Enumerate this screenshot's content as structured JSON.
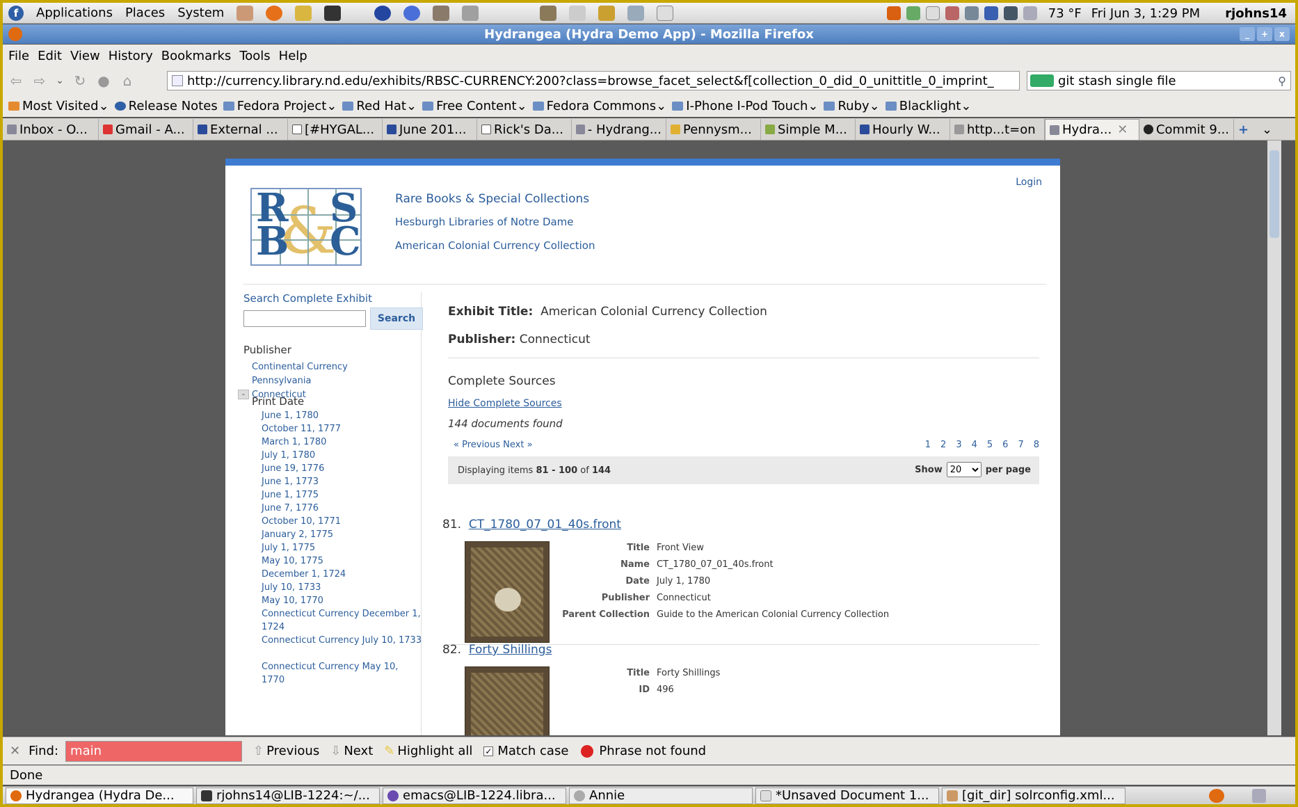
{
  "panel": {
    "menus": [
      "Applications",
      "Places",
      "System"
    ],
    "weather": "73 °F",
    "clock": "Fri Jun  3,  1:29 PM",
    "user": "rjohns14"
  },
  "window": {
    "title": "Hydrangea (Hydra Demo App) - Mozilla Firefox"
  },
  "menubar": [
    "File",
    "Edit",
    "View",
    "History",
    "Bookmarks",
    "Tools",
    "Help"
  ],
  "navbar": {
    "url": "http://currency.library.nd.edu/exhibits/RBSC-CURRENCY:200?class=browse_facet_select&f[collection_0_did_0_unittitle_0_imprint_",
    "search_value": "git stash single file"
  },
  "bookmarks": [
    "Most Visited",
    "Release Notes",
    "Fedora Project",
    "Red Hat",
    "Free Content",
    "Fedora Commons",
    "I-Phone I-Pod Touch",
    "Ruby",
    "Blacklight"
  ],
  "tabs": [
    "Inbox - O...",
    "Gmail - A...",
    "External ...",
    "[#HYGAL...",
    "June 201...",
    "Rick's Da...",
    "- Hydrang...",
    "Pennysm...",
    "Simple M...",
    "Hourly W...",
    "http...t=on",
    "Hydra...",
    "Commit 9..."
  ],
  "site": {
    "header_line1": "Rare Books & Special Collections",
    "header_line2": "Hesburgh Libraries of Notre Dame",
    "header_line3": "American Colonial Currency Collection",
    "login": "Login",
    "logo_letters": [
      "R",
      "S",
      "B",
      "C"
    ]
  },
  "sidebar": {
    "search_title": "Search Complete Exhibit",
    "search_button": "Search",
    "publisher_heading": "Publisher",
    "publishers": [
      "Continental Currency",
      "Pennsylvania",
      "Connecticut"
    ],
    "minus": "-",
    "print_date_heading": "Print Date",
    "dates": [
      "June 1, 1780",
      "October 11, 1777",
      "March 1, 1780",
      "July 1, 1780",
      "June 19, 1776",
      "June 1, 1773",
      "June 1, 1775",
      "June 7, 1776",
      "October 10, 1771",
      "January 2, 1775",
      "July 1, 1775",
      "May 10, 1775",
      "December 1, 1724",
      "July 10, 1733",
      "May 10, 1770",
      "Connecticut Currency December 1, 1724",
      "Connecticut Currency July 10, 1733",
      "Connecticut Currency May 10, 1770"
    ]
  },
  "main": {
    "exhibit_label": "Exhibit Title:",
    "exhibit_value": "American Colonial Currency Collection",
    "publisher_label": "Publisher:",
    "publisher_value": "Connecticut",
    "complete_sources": "Complete Sources",
    "hide_sources": "Hide Complete Sources",
    "docs_found": "144 documents found",
    "prev_next": "« Previous   Next »",
    "pages": [
      "1",
      "2",
      "3",
      "4",
      "5",
      "6",
      "7",
      "8"
    ],
    "display_prefix": "Displaying items ",
    "display_range": "81 - 100",
    "display_of": " of ",
    "display_total": "144",
    "show_label": "Show",
    "per_page_value": "20",
    "per_page_label": "per page",
    "items": [
      {
        "number": "81.",
        "title": "CT_1780_07_01_40s.front",
        "fields": [
          {
            "k": "Title",
            "v": "Front View"
          },
          {
            "k": "Name",
            "v": "CT_1780_07_01_40s.front"
          },
          {
            "k": "Date",
            "v": "July 1, 1780"
          },
          {
            "k": "Publisher",
            "v": "Connecticut"
          },
          {
            "k": "Parent Collection",
            "v": "Guide to the American Colonial Currency Collection"
          }
        ]
      },
      {
        "number": "82.",
        "title": "Forty Shillings",
        "fields": [
          {
            "k": "Title",
            "v": "Forty Shillings"
          },
          {
            "k": "ID",
            "v": "496"
          }
        ]
      }
    ]
  },
  "findbar": {
    "label": "Find:",
    "value": "main",
    "previous": "Previous",
    "next": "Next",
    "highlight": "Highlight all",
    "match_case": "Match case",
    "status": "Phrase not found"
  },
  "statusbar": "Done",
  "taskbar": [
    "Hydrangea (Hydra De...",
    "rjohns14@LIB-1224:~/...",
    "emacs@LIB-1224.libra...",
    "Annie",
    "*Unsaved Document 1...",
    "[git_dir] solrconfig.xml..."
  ]
}
